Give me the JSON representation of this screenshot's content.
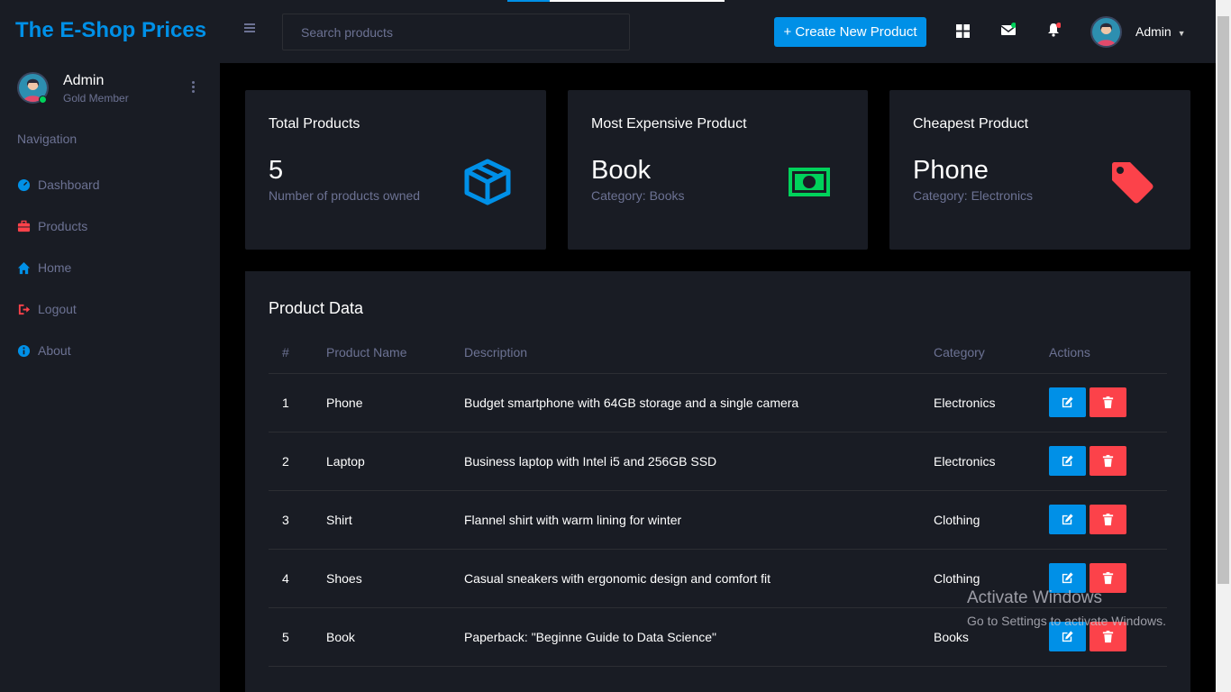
{
  "brand": "The E-Shop Prices",
  "search": {
    "placeholder": "Search products"
  },
  "header": {
    "create_label": "+ Create New Product",
    "user_name": "Admin"
  },
  "sidebar": {
    "user_name": "Admin",
    "user_role": "Gold Member",
    "category": "Navigation",
    "items": [
      {
        "label": "Dashboard",
        "icon": "speedometer-icon",
        "color": "#0090e7"
      },
      {
        "label": "Products",
        "icon": "briefcase-icon",
        "color": "#fc424a"
      },
      {
        "label": "Home",
        "icon": "home-icon",
        "color": "#0090e7"
      },
      {
        "label": "Logout",
        "icon": "logout-icon",
        "color": "#fc424a"
      },
      {
        "label": "About",
        "icon": "info-icon",
        "color": "#0090e7"
      }
    ]
  },
  "stats": [
    {
      "title": "Total Products",
      "value": "5",
      "sub": "Number of products owned",
      "icon": "cube-icon",
      "color": "#0090e7"
    },
    {
      "title": "Most Expensive Product",
      "value": "Book",
      "sub": "Category: Books",
      "icon": "cash-icon",
      "color": "#00d25b"
    },
    {
      "title": "Cheapest Product",
      "value": "Phone",
      "sub": "Category: Electronics",
      "icon": "tag-icon",
      "color": "#fc424a"
    }
  ],
  "table": {
    "title": "Product Data",
    "headers": [
      "#",
      "Product Name",
      "Description",
      "Category",
      "Actions"
    ],
    "rows": [
      {
        "id": "1",
        "name": "Phone",
        "description": "Budget smartphone with 64GB storage and a single camera",
        "category": "Electronics"
      },
      {
        "id": "2",
        "name": "Laptop",
        "description": "Business laptop with Intel i5 and 256GB SSD",
        "category": "Electronics"
      },
      {
        "id": "3",
        "name": "Shirt",
        "description": "Flannel shirt with warm lining for winter",
        "category": "Clothing"
      },
      {
        "id": "4",
        "name": "Shoes",
        "description": "Casual sneakers with ergonomic design and comfort fit",
        "category": "Clothing"
      },
      {
        "id": "5",
        "name": "Book",
        "description": "Paperback: \"Beginne Guide to Data Science\"",
        "category": "Books"
      }
    ]
  },
  "watermark": {
    "line1": "Activate Windows",
    "line2": "Go to Settings to activate Windows."
  }
}
